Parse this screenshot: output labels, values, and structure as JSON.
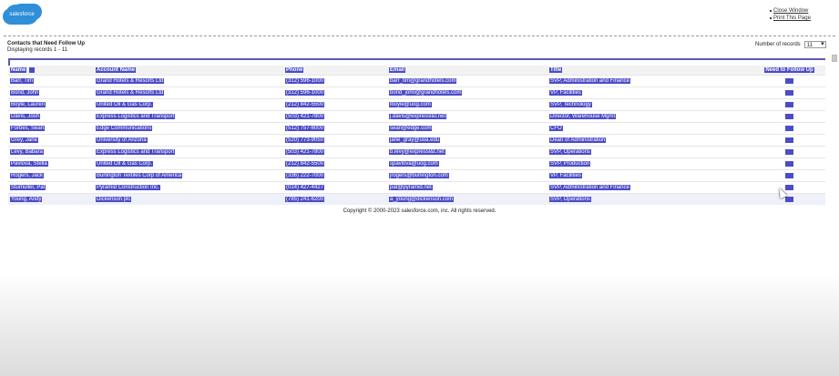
{
  "header": {
    "logo_text": "salesforce",
    "links": [
      "Close Window",
      "Print This Page"
    ]
  },
  "report": {
    "title": "Contacts that Need Follow Up",
    "subtitle": "Displaying records 1 - 11",
    "records_label": "Number of records",
    "records_value": "11"
  },
  "table": {
    "headers": [
      "Name",
      "Account Name",
      "Phone",
      "Email",
      "Title",
      "Need to Follow Up"
    ],
    "rows": [
      [
        "Barr, Tim",
        "Grand Hotels & Resorts Ltd",
        "(312) 596-1000",
        "barr_tim@grandhotels.com",
        "SVP, Administration and Finance"
      ],
      [
        "Bond, John",
        "Grand Hotels & Resorts Ltd",
        "(312) 596-1000",
        "bond_john@grandhotels.com",
        "VP, Facilities"
      ],
      [
        "Boyle, Lauren",
        "United Oil & Gas Corp.",
        "(212) 842-5500",
        "lboyle@uog.com",
        "SVP, Technology"
      ],
      [
        "Davis, Josh",
        "Express Logistics and Transport",
        "(503) 421-7800",
        "j.davis@expressl&t.net",
        "Director, Warehouse Mgmt"
      ],
      [
        "Forbes, Sean",
        "Edge Communications",
        "(512) 757-6000",
        "sean@edge.com",
        "CFO"
      ],
      [
        "Grey, Jane",
        "University of Arizona",
        "(520) 773-9050",
        "jane_gray@uoa.edu",
        "Dean of Administration"
      ],
      [
        "Levy, Babara",
        "Express Logistics and Transport",
        "(503) 421-7800",
        "b.levy@expressl&t.net",
        "SVP, Operations"
      ],
      [
        "Pavlova, Stella",
        "United Oil & Gas Corp.",
        "(212) 842-5500",
        "spavlova@uog.com",
        "SVP, Production"
      ],
      [
        "Rogers, Jack",
        "Burlington Textiles Corp of America",
        "(336) 222-7000",
        "jrogers@burlington.com",
        "VP, Facilities"
      ],
      [
        "Stumuller, Pat",
        "Pyramid Construction Inc.",
        "(014) 427-4427",
        "pat@pyramid.net",
        "SVP, Administration and Finance"
      ],
      [
        "Young, Andy",
        "Dickenson plc",
        "(785) 241-6200",
        "a_young@dickenson.com",
        "SVP, Operations"
      ]
    ]
  },
  "footer": {
    "copyright": "Copyright © 2000-2023 salesforce.com, inc. All rights reserved."
  },
  "colors": {
    "selection": "#4c4cc8",
    "table_border": "#5a5ab8"
  }
}
